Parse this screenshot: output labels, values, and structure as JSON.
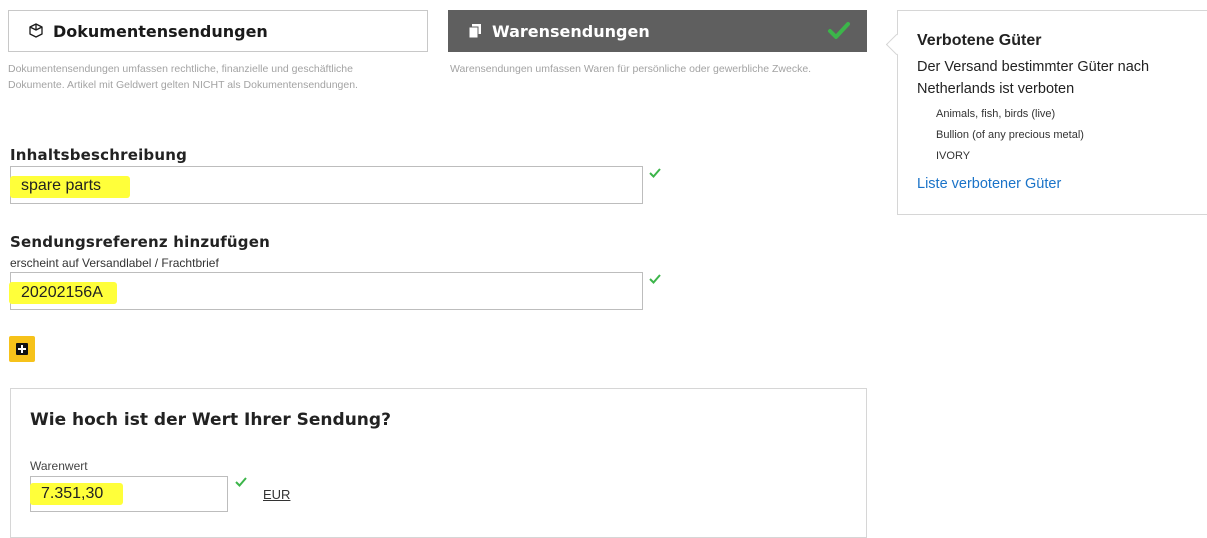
{
  "shipment_types": {
    "documents": {
      "label": "Dokumentensendungen",
      "description": "Dokumentensendungen umfassen rechtliche, finanzielle und geschäftliche Dokumente. Artikel mit Geldwert gelten NICHT als Dokumentensendungen.",
      "icon": "document-icon",
      "selected": false
    },
    "goods": {
      "label": "Warensendungen",
      "description": "Warensendungen umfassen Waren für persönliche oder gewerbliche Zwecke.",
      "icon": "package-icon",
      "selected": true
    }
  },
  "content_description": {
    "label": "Inhaltsbeschreibung",
    "value": "spare parts"
  },
  "shipment_reference": {
    "label": "Sendungsreferenz hinzufügen",
    "sublabel": "erscheint auf Versandlabel / Frachtbrief",
    "value": "20202156A"
  },
  "add_button": {
    "icon": "plus-icon"
  },
  "value_section": {
    "title": "Wie hoch ist der Wert Ihrer Sendung?",
    "field_label": "Warenwert",
    "value": "7.351,30",
    "currency": "EUR"
  },
  "prohibited_goods": {
    "title": "Verbotene Güter",
    "text": "Der Versand bestimmter Güter nach Netherlands ist verboten",
    "items": [
      "Animals, fish, birds (live)",
      "Bullion (of any precious metal)",
      "IVORY"
    ],
    "link": "Liste verbotener Güter"
  },
  "colors": {
    "accent_yellow": "#f6c21a",
    "highlight": "#ffff3a",
    "selected_tab": "#5f5f5f",
    "valid_green": "#3cb54a",
    "link_blue": "#1a73c8"
  }
}
